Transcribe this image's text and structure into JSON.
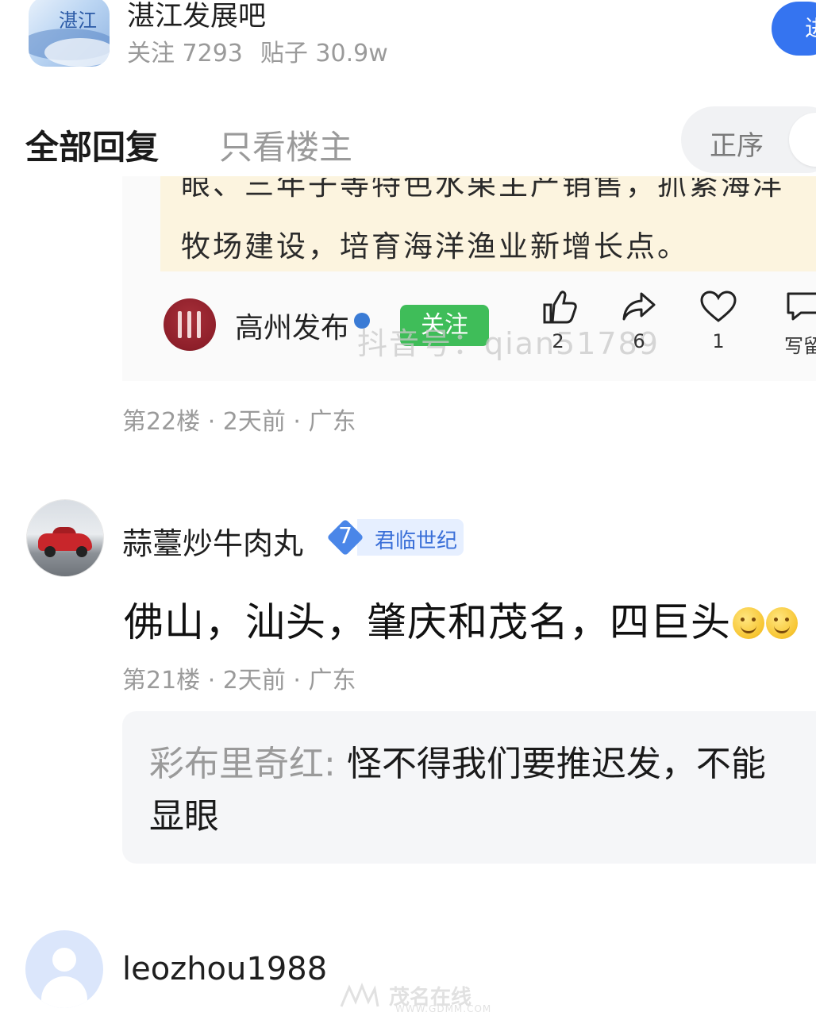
{
  "forum": {
    "name": "湛江发展吧",
    "follow_label": "关注 7293",
    "posts_label": "贴子 30.9w",
    "enter_label": "进"
  },
  "tabs": {
    "all_replies": "全部回复",
    "op_only": "只看楼主"
  },
  "sort": {
    "label": "正序"
  },
  "embedded_screenshot": {
    "text_cut_line": "眼、三年子等特色水果主产销售，抓紧海洋",
    "text_line": "牧场建设，培育海洋渔业新增长点。",
    "source_name": "高州发布",
    "follow_button": "关注",
    "watermark": "抖音号：qian51789",
    "actions": [
      {
        "icon": "thumbs-up-icon",
        "count": "2"
      },
      {
        "icon": "share-icon",
        "count": "6"
      },
      {
        "icon": "heart-icon",
        "count": "1"
      },
      {
        "icon": "comment-icon",
        "count": "写留"
      }
    ]
  },
  "floor22": {
    "meta": "第22楼 · 2天前 · 广东"
  },
  "floor21": {
    "username": "蒜薹炒牛肉丸",
    "level": "7",
    "level_title": "君临世纪",
    "content": "佛山，汕头，肇庆和茂名，四巨头",
    "meta": "第21楼 · 2天前 · 广东",
    "subreply": {
      "author": "彩布里奇红:",
      "text_line1": "怪不得我们要推迟发，不能",
      "text_line2": "显眼"
    }
  },
  "next_reply": {
    "username": "leozhou1988"
  },
  "site_watermark": {
    "name": "茂名在线",
    "url": "WWW.GDMM.COM"
  },
  "colors": {
    "accent_blue": "#3574f0",
    "follow_green": "#3fbd59",
    "meta_gray": "#9a9a9a"
  }
}
